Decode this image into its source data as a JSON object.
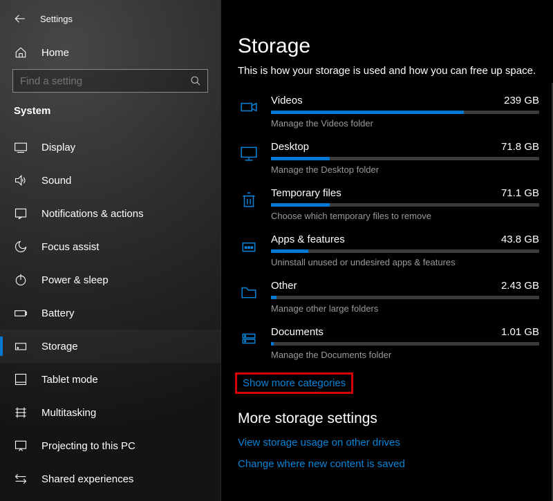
{
  "window": {
    "title": "Settings"
  },
  "sidebar": {
    "home": "Home",
    "search_placeholder": "Find a setting",
    "group": "System",
    "items": [
      {
        "id": "display",
        "label": "Display"
      },
      {
        "id": "sound",
        "label": "Sound"
      },
      {
        "id": "notifications",
        "label": "Notifications & actions"
      },
      {
        "id": "focus",
        "label": "Focus assist"
      },
      {
        "id": "power",
        "label": "Power & sleep"
      },
      {
        "id": "battery",
        "label": "Battery"
      },
      {
        "id": "storage",
        "label": "Storage",
        "active": true
      },
      {
        "id": "tablet",
        "label": "Tablet mode"
      },
      {
        "id": "multitask",
        "label": "Multitasking"
      },
      {
        "id": "projecting",
        "label": "Projecting to this PC"
      },
      {
        "id": "shared",
        "label": "Shared experiences"
      }
    ]
  },
  "page": {
    "title": "Storage",
    "subtitle": "This is how your storage is used and how you can free up space.",
    "categories": [
      {
        "name": "Videos",
        "size": "239 GB",
        "fill_pct": 72,
        "desc": "Manage the Videos folder"
      },
      {
        "name": "Desktop",
        "size": "71.8 GB",
        "fill_pct": 22,
        "desc": "Manage the Desktop folder"
      },
      {
        "name": "Temporary files",
        "size": "71.1 GB",
        "fill_pct": 22,
        "desc": "Choose which temporary files to remove"
      },
      {
        "name": "Apps & features",
        "size": "43.8 GB",
        "fill_pct": 14,
        "desc": "Uninstall unused or undesired apps & features"
      },
      {
        "name": "Other",
        "size": "2.43 GB",
        "fill_pct": 2,
        "desc": "Manage other large folders"
      },
      {
        "name": "Documents",
        "size": "1.01 GB",
        "fill_pct": 1,
        "desc": "Manage the Documents folder"
      }
    ],
    "show_more": "Show more categories",
    "more_heading": "More storage settings",
    "links": [
      "View storage usage on other drives",
      "Change where new content is saved"
    ]
  }
}
